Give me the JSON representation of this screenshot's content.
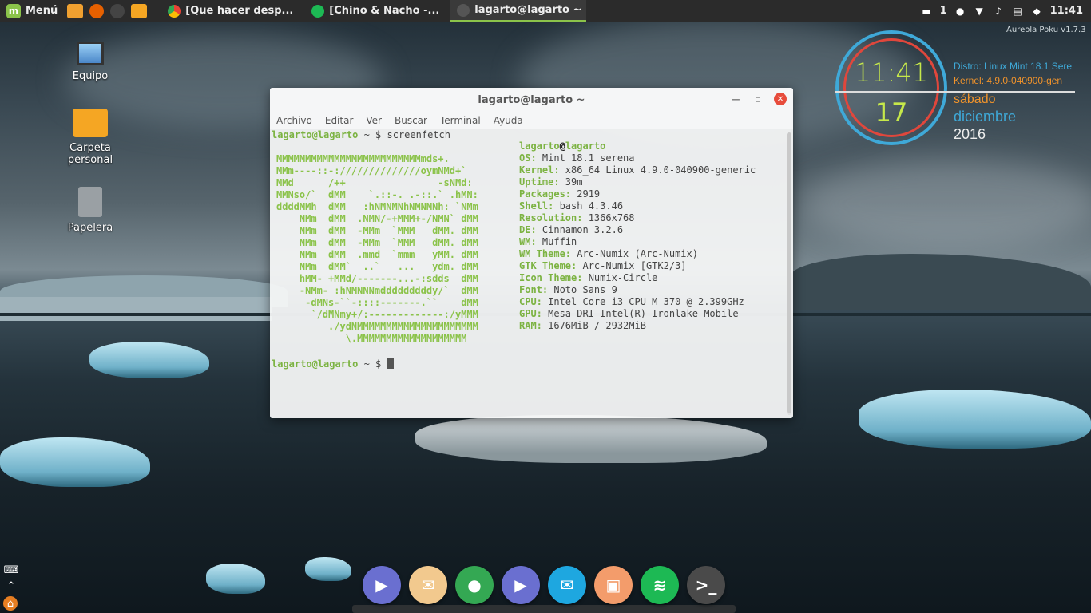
{
  "panel": {
    "menu_label": "Menú",
    "tasks": [
      {
        "label": "[Que hacer desp..."
      },
      {
        "label": "[Chino & Nacho -..."
      },
      {
        "label": "lagarto@lagarto ~"
      }
    ],
    "tray": {
      "notifications": "1",
      "clock": "11:41"
    }
  },
  "desktop": {
    "icons": [
      {
        "label": "Equipo"
      },
      {
        "label": "Carpeta personal"
      },
      {
        "label": "Papelera"
      }
    ]
  },
  "conky": {
    "theme": "Aureola Poku v1.7.3",
    "time": "11:41",
    "day_number": "17",
    "distro": "Distro: Linux Mint 18.1 Sere",
    "kernel": "Kernel: 4.9.0-040900-gen",
    "weekday": "sábado",
    "month": "diciembre",
    "year": "2016",
    "colors": {
      "ring_outer": "#3fa9d8",
      "ring_inner": "#e0473c",
      "accent_green": "#c6e84a",
      "accent_orange": "#f0932b",
      "accent_blue": "#3fa9d8"
    }
  },
  "terminal": {
    "title": "lagarto@lagarto ~",
    "menu": [
      "Archivo",
      "Editar",
      "Ver",
      "Buscar",
      "Terminal",
      "Ayuda"
    ],
    "prompt_user": "lagarto@lagarto",
    "prompt_rest": " ~ $ ",
    "command": "screenfetch",
    "header_user": "lagarto",
    "header_at": "@",
    "header_host": "lagarto",
    "ascii": [
      "MMMMMMMMMMMMMMMMMMMMMMMMMmds+.",
      "MMm----::-://////////////oymNMd+`",
      "MMd      /++                -sNMd:",
      "MMNso/`  dMM    `.::-. .-::.` .hMN:",
      "ddddMMh  dMM   :hNMNMNhNMNMNh: `NMm",
      "    NMm  dMM  .NMN/-+MMM+-/NMN` dMM",
      "    NMm  dMM  -MMm  `MMM   dMM. dMM",
      "    NMm  dMM  -MMm  `MMM   dMM. dMM",
      "    NMm  dMM  .mmd  `mmm   yMM. dMM",
      "    NMm  dMM`  ..`   ...   ydm. dMM",
      "    hMM- +MMd/-------...-:sdds  dMM",
      "    -NMm- :hNMNNNmdddddddddy/`  dMM",
      "     -dMNs-``-::::-------.``    dMM",
      "      `/dMNmy+/:-------------:/yMMM",
      "         ./ydNMMMMMMMMMMMMMMMMMMMMM",
      "            \\.MMMMMMMMMMMMMMMMMMM"
    ],
    "info": [
      {
        "key": "OS:",
        "value": " Mint 18.1 serena"
      },
      {
        "key": "Kernel:",
        "value": " x86_64 Linux 4.9.0-040900-generic"
      },
      {
        "key": "Uptime:",
        "value": " 39m"
      },
      {
        "key": "Packages:",
        "value": " 2919"
      },
      {
        "key": "Shell:",
        "value": " bash 4.3.46"
      },
      {
        "key": "Resolution:",
        "value": " 1366x768"
      },
      {
        "key": "DE:",
        "value": " Cinnamon 3.2.6"
      },
      {
        "key": "WM:",
        "value": " Muffin"
      },
      {
        "key": "WM Theme:",
        "value": " Arc-Numix (Arc-Numix)"
      },
      {
        "key": "GTK Theme:",
        "value": " Arc-Numix [GTK2/3]"
      },
      {
        "key": "Icon Theme:",
        "value": " Numix-Circle"
      },
      {
        "key": "Font:",
        "value": " Noto Sans 9"
      },
      {
        "key": "CPU:",
        "value": " Intel Core i3 CPU M 370 @ 2.399GHz"
      },
      {
        "key": "GPU:",
        "value": " Mesa DRI Intel(R) Ironlake Mobile"
      },
      {
        "key": "RAM:",
        "value": " 1676MiB / 2932MiB"
      }
    ]
  },
  "dock": {
    "apps": [
      {
        "icon": "media-player-icon",
        "glyph": "▶",
        "color": "#6a6fd0"
      },
      {
        "icon": "mail-client-icon",
        "glyph": "✉",
        "color": "#f2c98e"
      },
      {
        "icon": "chrome-icon",
        "glyph": "●",
        "color": "#34a853"
      },
      {
        "icon": "video-player-icon",
        "glyph": "▶",
        "color": "#6a6fd0"
      },
      {
        "icon": "mail-icon",
        "glyph": "✉",
        "color": "#1ea7e0"
      },
      {
        "icon": "image-viewer-icon",
        "glyph": "▣",
        "color": "#f39c6b"
      },
      {
        "icon": "spotify-icon",
        "glyph": "≋",
        "color": "#1db954"
      },
      {
        "icon": "terminal-icon",
        "glyph": ">_",
        "color": "#4a4a4a"
      }
    ]
  }
}
